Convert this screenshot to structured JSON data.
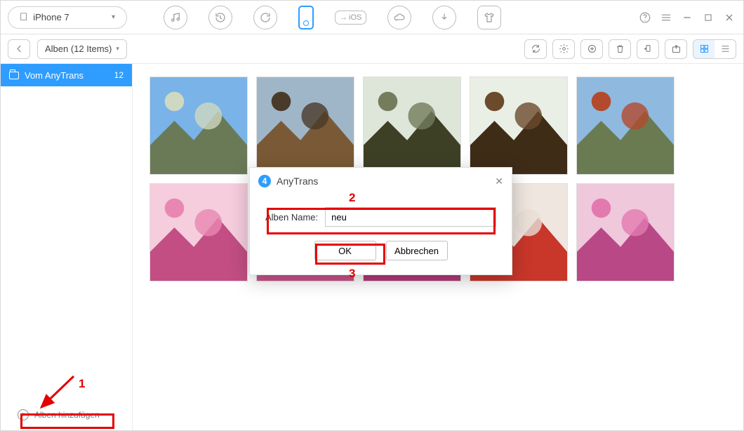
{
  "device": {
    "label": "iPhone 7"
  },
  "breadcrumb": {
    "label": "Alben (12 Items)"
  },
  "sidebar": {
    "items": [
      {
        "label": "Vom AnyTrans",
        "count": "12"
      }
    ],
    "add_label": "Alben hinzufügen"
  },
  "dialog": {
    "title": "AnyTrans",
    "field_label": "Alben Name:",
    "value": "neu",
    "ok": "OK",
    "cancel": "Abbrechen"
  },
  "annotations": {
    "n1": "1",
    "n2": "2",
    "n3": "3"
  },
  "thumbs": [
    {
      "id": "castle",
      "c1": "#79b3e8",
      "c2": "#cfd8c0",
      "c3": "#6a7a57"
    },
    {
      "id": "temple1",
      "c1": "#9fb6c8",
      "c2": "#4a3a29",
      "c3": "#7a5a36"
    },
    {
      "id": "lanterns",
      "c1": "#dde6d8",
      "c2": "#747c5d",
      "c3": "#3e4026"
    },
    {
      "id": "temple2",
      "c1": "#e9efe4",
      "c2": "#6c4a2c",
      "c3": "#3e2c17"
    },
    {
      "id": "torii",
      "c1": "#8fb9df",
      "c2": "#b34a2d",
      "c3": "#6a7b52"
    },
    {
      "id": "sakura1",
      "c1": "#f5cddd",
      "c2": "#e987b2",
      "c3": "#c24e83"
    },
    {
      "id": "sakura2",
      "c1": "#f6d1df",
      "c2": "#ed87b5",
      "c3": "#c9548b"
    },
    {
      "id": "sakura3",
      "c1": "#f2c1d8",
      "c2": "#df6aa6",
      "c3": "#b23a7a"
    },
    {
      "id": "person",
      "c1": "#efe6df",
      "c2": "#e7dfd6",
      "c3": "#c9362a"
    },
    {
      "id": "sakura4",
      "c1": "#efc8dc",
      "c2": "#e27ab0",
      "c3": "#b94887"
    }
  ]
}
